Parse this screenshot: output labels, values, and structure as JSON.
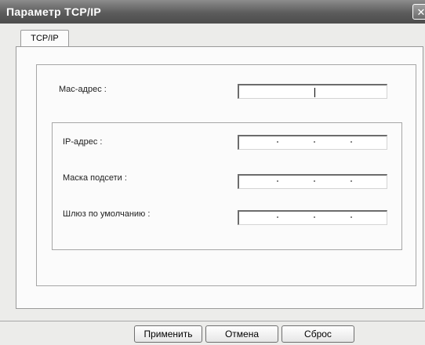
{
  "window": {
    "title": "Параметр TCP/IP",
    "close_glyph": "✕"
  },
  "tabs": [
    {
      "label": "TCP/IP",
      "selected": true
    }
  ],
  "fields": {
    "mac_label": "Mac-адрес :",
    "mac_value": "",
    "ip_label": "IP-адрес :",
    "ip_value": "",
    "mask_label": "Маска подсети :",
    "mask_value": "",
    "gateway_label": "Шлюз по умолчанию :",
    "gateway_value": ""
  },
  "buttons": {
    "apply": "Применить",
    "cancel": "Отмена",
    "reset": "Сброс"
  },
  "icons": {
    "close": "close-icon"
  }
}
